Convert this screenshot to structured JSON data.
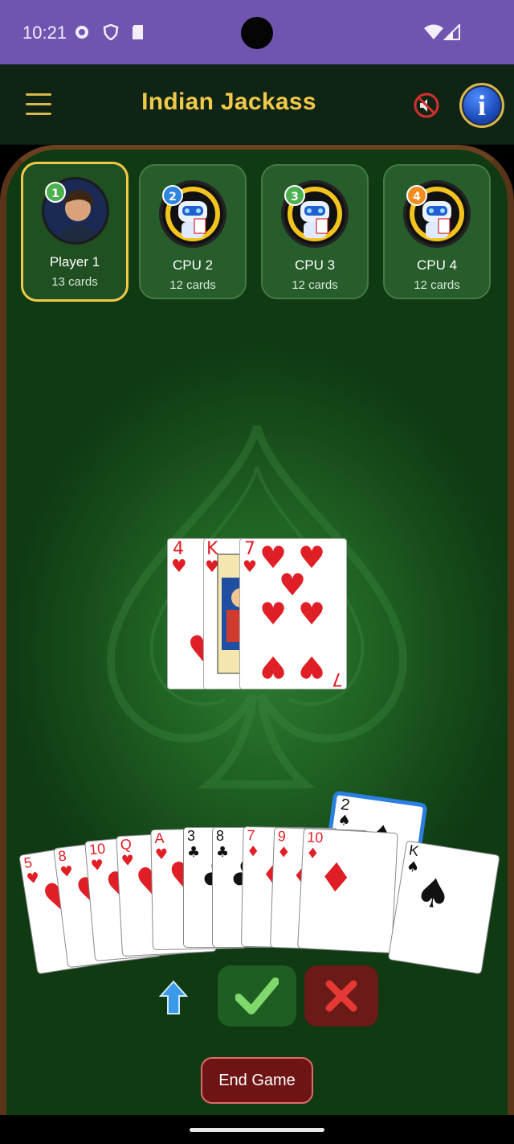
{
  "status_bar": {
    "time": "10:21"
  },
  "app_bar": {
    "title": "Indian Jackass"
  },
  "players": [
    {
      "badge": "1",
      "name": "Player 1",
      "cards": "13 cards",
      "badge_color": "#4caf50",
      "active": true
    },
    {
      "badge": "2",
      "name": "CPU 2",
      "cards": "12 cards",
      "badge_color": "#2f86e0",
      "active": false
    },
    {
      "badge": "3",
      "name": "CPU 3",
      "cards": "12 cards",
      "badge_color": "#4caf50",
      "active": false
    },
    {
      "badge": "4",
      "name": "CPU 4",
      "cards": "12 cards",
      "badge_color": "#f28c1c",
      "active": false
    }
  ],
  "center_pile": [
    {
      "rank": "4",
      "suit": "♥"
    },
    {
      "rank": "K",
      "suit": "♥"
    },
    {
      "rank": "7",
      "suit": "♥"
    }
  ],
  "hand": [
    {
      "rank": "5",
      "suit": "♥"
    },
    {
      "rank": "8",
      "suit": "♥"
    },
    {
      "rank": "10",
      "suit": "♥"
    },
    {
      "rank": "Q",
      "suit": "♥"
    },
    {
      "rank": "A",
      "suit": "♥"
    },
    {
      "rank": "3",
      "suit": "♣"
    },
    {
      "rank": "8",
      "suit": "♣"
    },
    {
      "rank": "7",
      "suit": "♦"
    },
    {
      "rank": "9",
      "suit": "♦"
    },
    {
      "rank": "10",
      "suit": "♦"
    },
    {
      "rank": "2",
      "suit": "♠"
    },
    {
      "rank": "K",
      "suit": "♠"
    }
  ],
  "selected_card": {
    "rank": "2",
    "suit": "♠"
  },
  "actions": {
    "end_game": "End Game"
  }
}
